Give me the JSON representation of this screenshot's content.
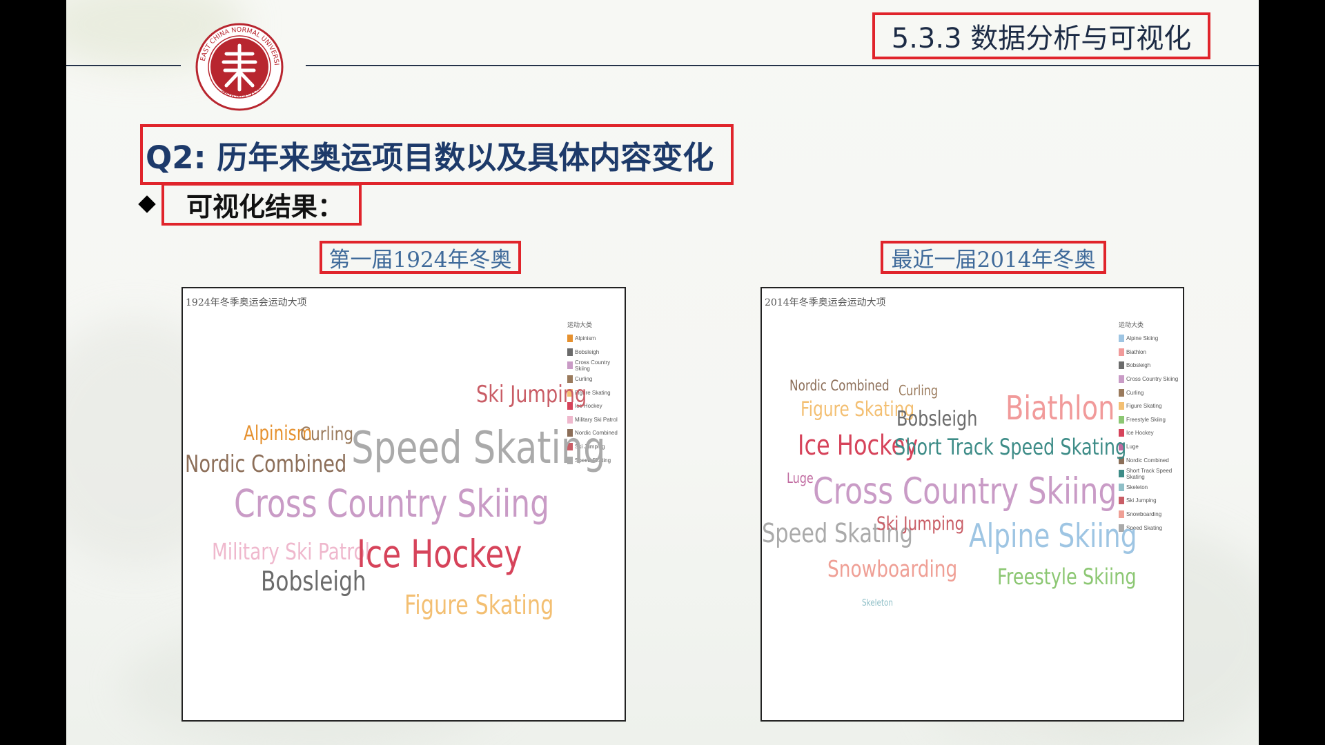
{
  "header": {
    "section_title": "5.3.3 数据分析与可视化",
    "logo_text": "EAST CHINA NORMAL UNIVERSITY 华东师范大学"
  },
  "question_title": "Q2: 历年来奥运项目数以及具体内容变化",
  "bullet": {
    "label": "可视化结果："
  },
  "panels": [
    {
      "caption": "第一届1924年冬奥",
      "chart_title": "1924年冬季奥运会运动大项",
      "legend_title": "运动大类",
      "legend": [
        {
          "label": "Alpinism",
          "color": "#e6912f"
        },
        {
          "label": "Bobsleigh",
          "color": "#6b6b6b"
        },
        {
          "label": "Cross Country Skiing",
          "color": "#c99bc6"
        },
        {
          "label": "Curling",
          "color": "#9a7a5c"
        },
        {
          "label": "Figure Skating",
          "color": "#f3bf72"
        },
        {
          "label": "Ice Hockey",
          "color": "#d6435a"
        },
        {
          "label": "Military Ski Patrol",
          "color": "#efb8cd"
        },
        {
          "label": "Nordic Combined",
          "color": "#8c6e58"
        },
        {
          "label": "Ski Jumping",
          "color": "#c95d66"
        },
        {
          "label": "Speed Skating",
          "color": "#aaaaaa"
        }
      ],
      "words": [
        {
          "text": "Ski Jumping",
          "color": "#c95d66"
        },
        {
          "text": "Alpinism",
          "color": "#e6912f"
        },
        {
          "text": "Curling",
          "color": "#9a7a5c"
        },
        {
          "text": "Nordic Combined",
          "color": "#8c6e58"
        },
        {
          "text": "Speed Skating",
          "color": "#aaaaaa"
        },
        {
          "text": "Cross Country Skiing",
          "color": "#c99bc6"
        },
        {
          "text": "Military Ski Patrol",
          "color": "#efb8cd"
        },
        {
          "text": "Ice Hockey",
          "color": "#d6435a"
        },
        {
          "text": "Bobsleigh",
          "color": "#6b6b6b"
        },
        {
          "text": "Figure Skating",
          "color": "#f3bf72"
        }
      ]
    },
    {
      "caption": "最近一届2014年冬奥",
      "chart_title": "2014年冬季奥运会运动大项",
      "legend_title": "运动大类",
      "legend": [
        {
          "label": "Alpine Skiing",
          "color": "#9ec5e3"
        },
        {
          "label": "Biathlon",
          "color": "#f19a9a"
        },
        {
          "label": "Bobsleigh",
          "color": "#6b6b6b"
        },
        {
          "label": "Cross Country Skiing",
          "color": "#c99bc6"
        },
        {
          "label": "Curling",
          "color": "#9a7a5c"
        },
        {
          "label": "Figure Skating",
          "color": "#f3bf72"
        },
        {
          "label": "Freestyle Skiing",
          "color": "#8cc773"
        },
        {
          "label": "Ice Hockey",
          "color": "#d6435a"
        },
        {
          "label": "Luge",
          "color": "#c06aa0"
        },
        {
          "label": "Nordic Combined",
          "color": "#8c6e58"
        },
        {
          "label": "Short Track Speed Skating",
          "color": "#3d8c87"
        },
        {
          "label": "Skeleton",
          "color": "#8fbfc7"
        },
        {
          "label": "Ski Jumping",
          "color": "#c95d66"
        },
        {
          "label": "Snowboarding",
          "color": "#ef9f95"
        },
        {
          "label": "Speed Skating",
          "color": "#aaaaaa"
        }
      ],
      "words": [
        {
          "text": "Nordic Combined",
          "color": "#8c6e58"
        },
        {
          "text": "Curling",
          "color": "#9a7a5c"
        },
        {
          "text": "Figure Skating",
          "color": "#f3bf72"
        },
        {
          "text": "Bobsleigh",
          "color": "#6b6b6b"
        },
        {
          "text": "Biathlon",
          "color": "#f19a9a"
        },
        {
          "text": "Ice Hockey",
          "color": "#d6435a"
        },
        {
          "text": "Short Track Speed Skating",
          "color": "#3d8c87"
        },
        {
          "text": "Luge",
          "color": "#c06aa0"
        },
        {
          "text": "Cross Country Skiing",
          "color": "#c99bc6"
        },
        {
          "text": "Speed Skating",
          "color": "#aaaaaa"
        },
        {
          "text": "Ski Jumping",
          "color": "#c95d66"
        },
        {
          "text": "Alpine Skiing",
          "color": "#9ec5e3"
        },
        {
          "text": "Snowboarding",
          "color": "#ef9f95"
        },
        {
          "text": "Freestyle Skiing",
          "color": "#8cc773"
        },
        {
          "text": "Skeleton",
          "color": "#8fbfc7"
        }
      ]
    }
  ]
}
